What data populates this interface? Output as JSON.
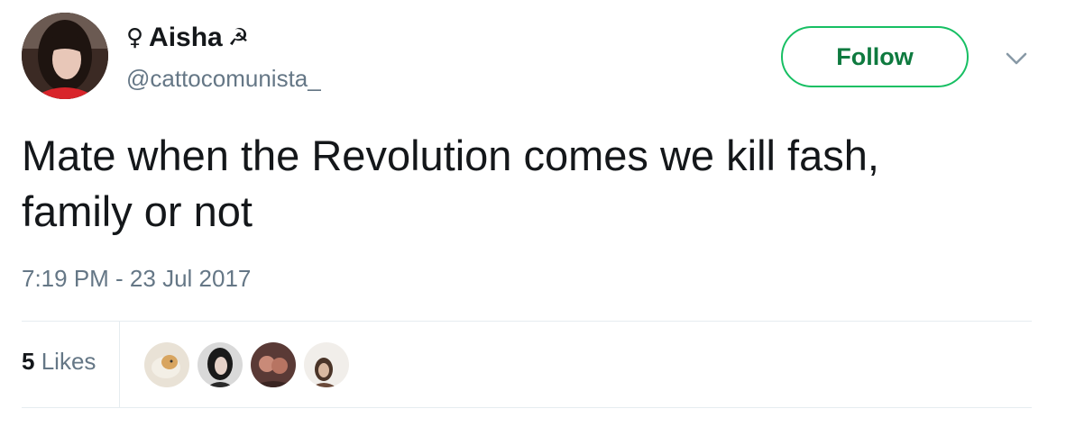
{
  "tweet": {
    "user": {
      "display_name": "Aisha",
      "name_prefix_emoji": "♀",
      "name_suffix_emoji": "☭",
      "handle": "@cattocomunista_",
      "avatar_icon": "user-avatar"
    },
    "follow_label": "Follow",
    "text": "Mate when the Revolution comes we kill fash, family or not",
    "timestamp": "7:19 PM - 23 Jul 2017",
    "likes": {
      "count": "5",
      "label": "Likes"
    },
    "colors": {
      "follow_border": "#17bf63",
      "follow_text": "#0e7a3f",
      "secondary_text": "#657786",
      "divider": "#e6ecf0"
    }
  }
}
